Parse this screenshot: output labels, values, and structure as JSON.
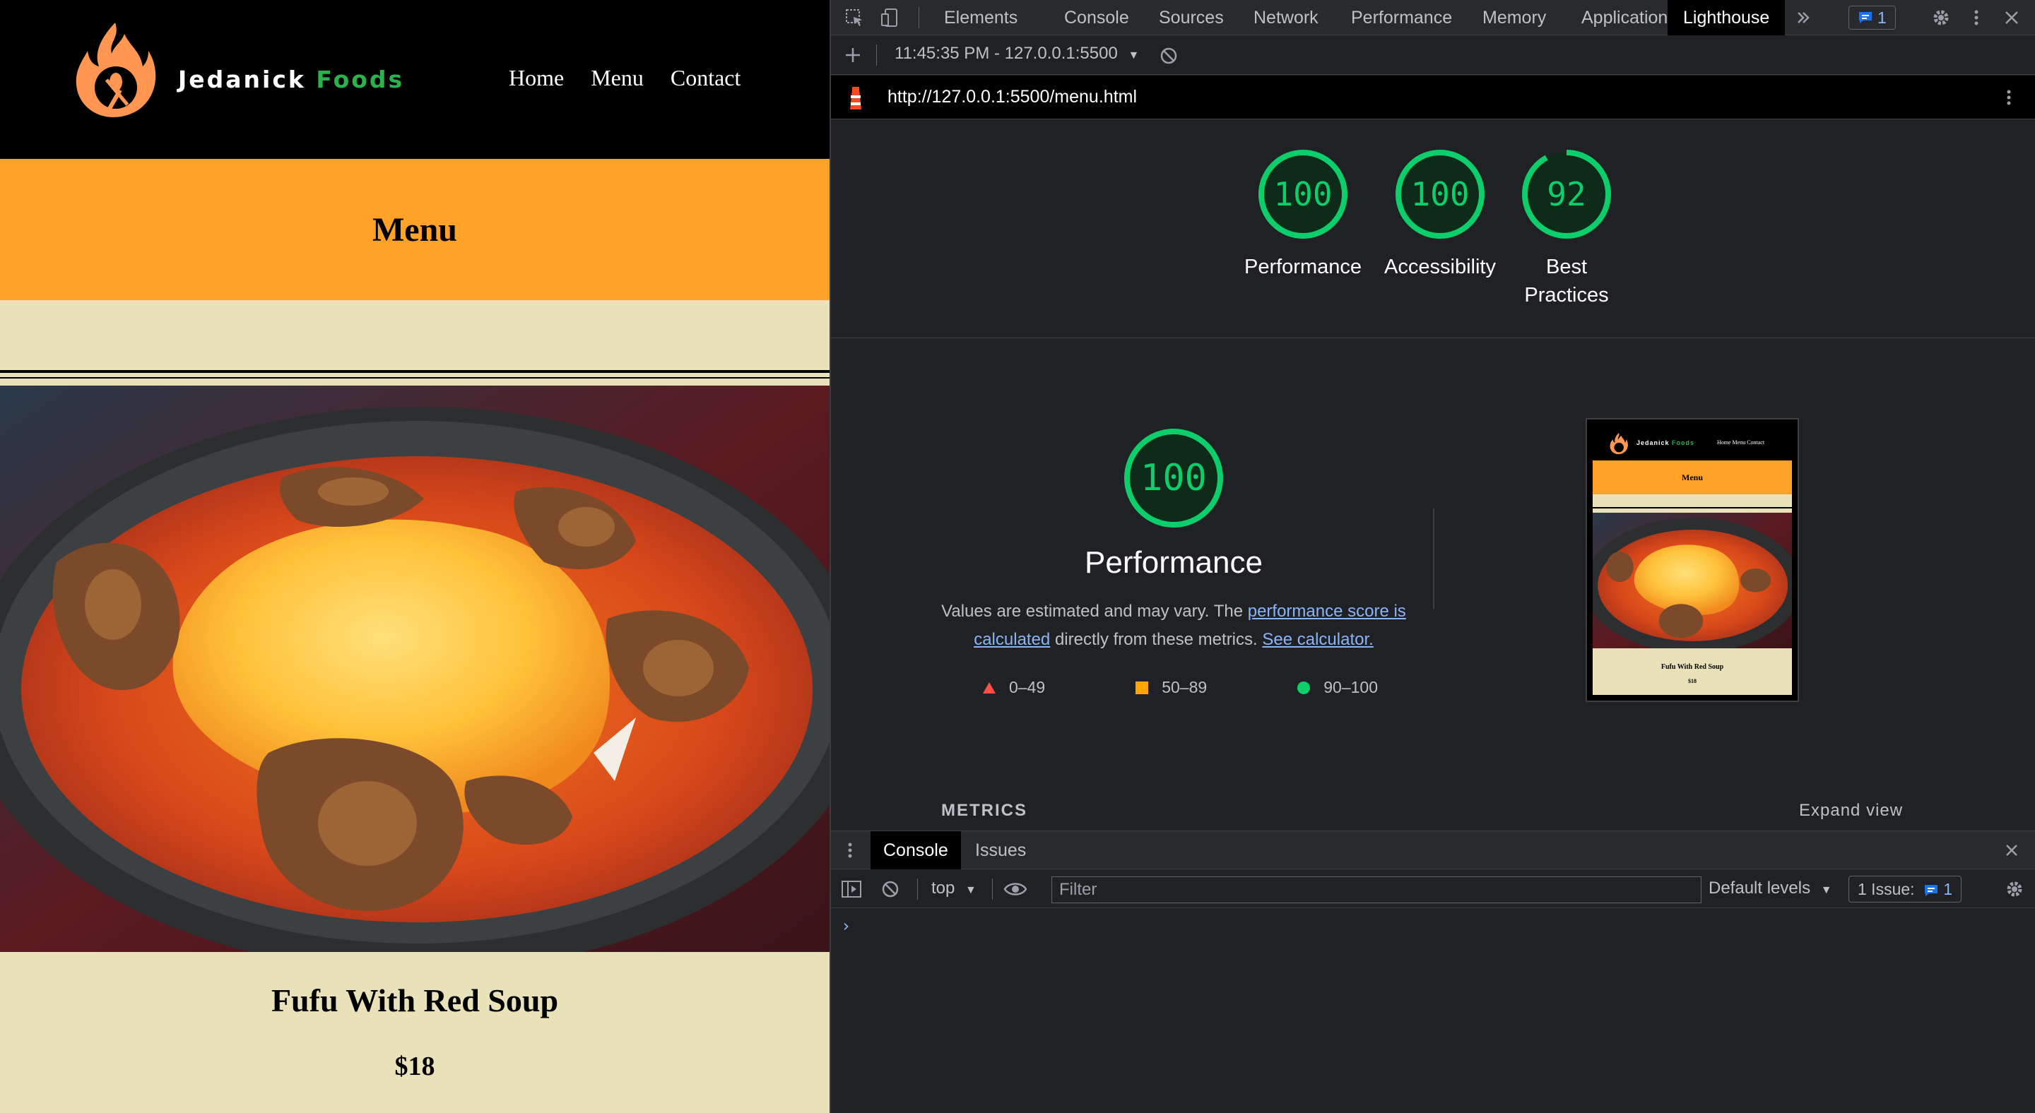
{
  "site": {
    "brand_first": "Jedanick",
    "brand_second": "Foods",
    "nav": [
      "Home",
      "Menu",
      "Contact"
    ],
    "banner_title": "Menu",
    "item": {
      "name": "Fufu With Red Soup",
      "price": "$18"
    }
  },
  "devtools": {
    "tabs": [
      "Elements",
      "Console",
      "Sources",
      "Network",
      "Performance",
      "Memory",
      "Application",
      "Lighthouse"
    ],
    "active_tab": "Lighthouse",
    "issues_badge": "1",
    "report_select": "11:45:35 PM - 127.0.0.1:5500",
    "url": "http://127.0.0.1:5500/menu.html",
    "scores": [
      {
        "label": "Performance",
        "value": 100
      },
      {
        "label": "Accessibility",
        "value": 100
      },
      {
        "label": "Best Practices",
        "value": 92
      }
    ],
    "perf": {
      "score": "100",
      "title": "Performance",
      "desc_prefix": "Values are estimated and may vary. The ",
      "desc_link": "performance score is calculated",
      "desc_mid": " directly from these metrics. ",
      "desc_link2": "See calculator.",
      "legend": [
        "0–49",
        "50–89",
        "90–100"
      ]
    },
    "thumb": {
      "brand_first": "Jedanick",
      "brand_second": "Foods",
      "nav": "Home   Menu   Contact",
      "banner": "Menu",
      "name": "Fufu With Red Soup",
      "price": "$18"
    },
    "metrics_label": "METRICS",
    "expand_view": "Expand view",
    "drawer": {
      "tabs": [
        "Console",
        "Issues"
      ],
      "context": "top",
      "filter_placeholder": "Filter",
      "levels": "Default levels",
      "issue_count_label": "1 Issue:",
      "issue_count": "1",
      "prompt": "›"
    },
    "colors": {
      "pass": "#0cce6b",
      "average": "#ffa400",
      "fail": "#ff4e42",
      "accent": "#ffa227"
    }
  }
}
